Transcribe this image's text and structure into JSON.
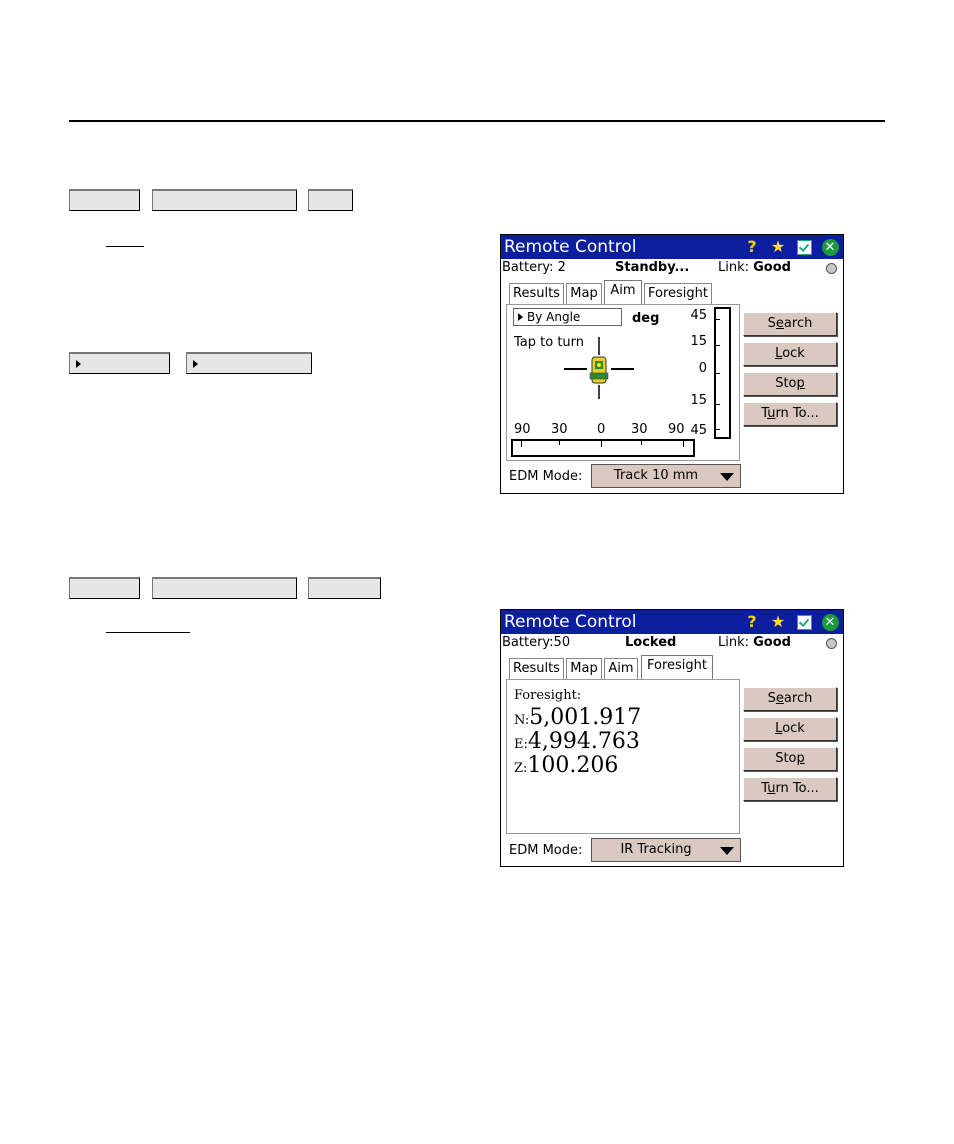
{
  "win1": {
    "title": "Remote Control",
    "battery": "Battery: 2",
    "status": "Standby...",
    "link_label": "Link: ",
    "link_value": "Good",
    "tabs": [
      "Results",
      "Map",
      "Aim",
      "Foresight"
    ],
    "active_tab": "Aim",
    "by_angle": "By Angle",
    "unit": "deg",
    "tap_to_turn": "Tap to turn",
    "vert_scale": [
      "45",
      "15",
      "0",
      "15",
      "45"
    ],
    "horiz_scale": [
      "90",
      "30",
      "0",
      "30",
      "90"
    ],
    "edm_label": "EDM Mode:",
    "edm_value": "Track 10 mm"
  },
  "win2": {
    "title": "Remote Control",
    "battery": "Battery:50",
    "status": "Locked",
    "link_label": "Link: ",
    "link_value": "Good",
    "tabs": [
      "Results",
      "Map",
      "Aim",
      "Foresight"
    ],
    "active_tab": "Foresight",
    "foresight_label": "Foresight:",
    "n_label": "N:",
    "n_value": "5,001.917",
    "e_label": "E:",
    "e_value": "4,994.763",
    "z_label": "Z:",
    "z_value": "100.206",
    "edm_label": "EDM Mode:",
    "edm_value": "IR Tracking"
  },
  "side_buttons": {
    "search_pre": "S",
    "search_u": "e",
    "search_post": "arch",
    "lock_u": "L",
    "lock_post": "ock",
    "stop_pre": "Sto",
    "stop_u": "p",
    "turn_pre": "T",
    "turn_u": "u",
    "turn_post": "rn To..."
  },
  "icons": {
    "help": "help-icon",
    "favorite": "star-icon",
    "task": "task-icon",
    "close": "close-icon"
  },
  "colors": {
    "titlebar": "#0a1e9e",
    "button_face": "#d9c9c0",
    "close_green": "#1a9a3a"
  }
}
